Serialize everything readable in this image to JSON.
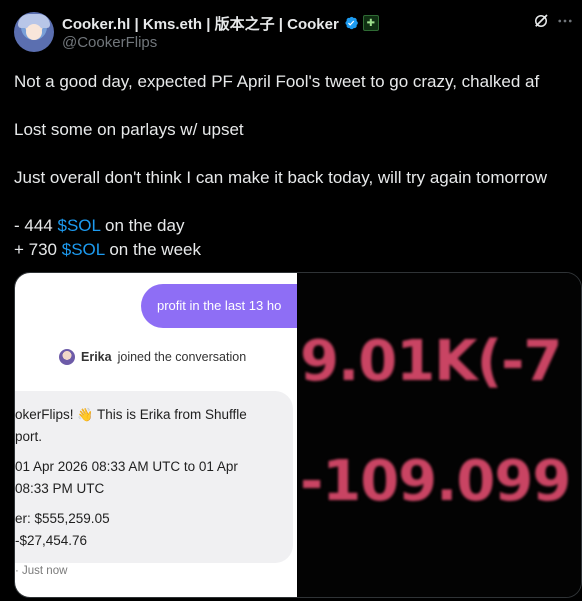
{
  "author": {
    "display_name": "Cooker.hl | Kms.eth | 版本之子 | Cooker",
    "handle": "@CookerFlips",
    "verified_icon": "verified-badge-icon",
    "affiliate_icon": "affiliate-badge-icon"
  },
  "header_actions": {
    "grok": "grok-icon",
    "more": "more-icon"
  },
  "tweet": {
    "lines": [
      "Not a good day, expected PF April Fool's tweet to go crazy, chalked af",
      "Lost some on parlays w/ upset",
      "Just overall don't think I can make it back today, will try again tomorrow"
    ],
    "day_prefix": "- 444 ",
    "day_cashtag": "$SOL",
    "day_suffix": " on the day",
    "week_prefix": "+ 730 ",
    "week_cashtag": "$SOL",
    "week_suffix": " on the week"
  },
  "media": {
    "left": {
      "user_message": "profit in the last 13 ho",
      "agent_name": "Erika",
      "joined_text": "joined the conversation",
      "line1_pre": "okerFlips! ",
      "line1_post": " This is Erika from Shuffle",
      "line2": "port.",
      "line3": " 01 Apr 2026 08:33 AM UTC to 01 Apr",
      "line4": " 08:33 PM UTC",
      "line5": "er: $555,259.05",
      "line6": " -$27,454.76",
      "timestamp": "· Just now"
    },
    "right": {
      "value1": "9.01K(-7",
      "value2": "-109.099"
    }
  },
  "colors": {
    "cashtag": "#1d9bf0",
    "accent_purple": "#8e6ef5",
    "loss_red": "#c94463"
  }
}
